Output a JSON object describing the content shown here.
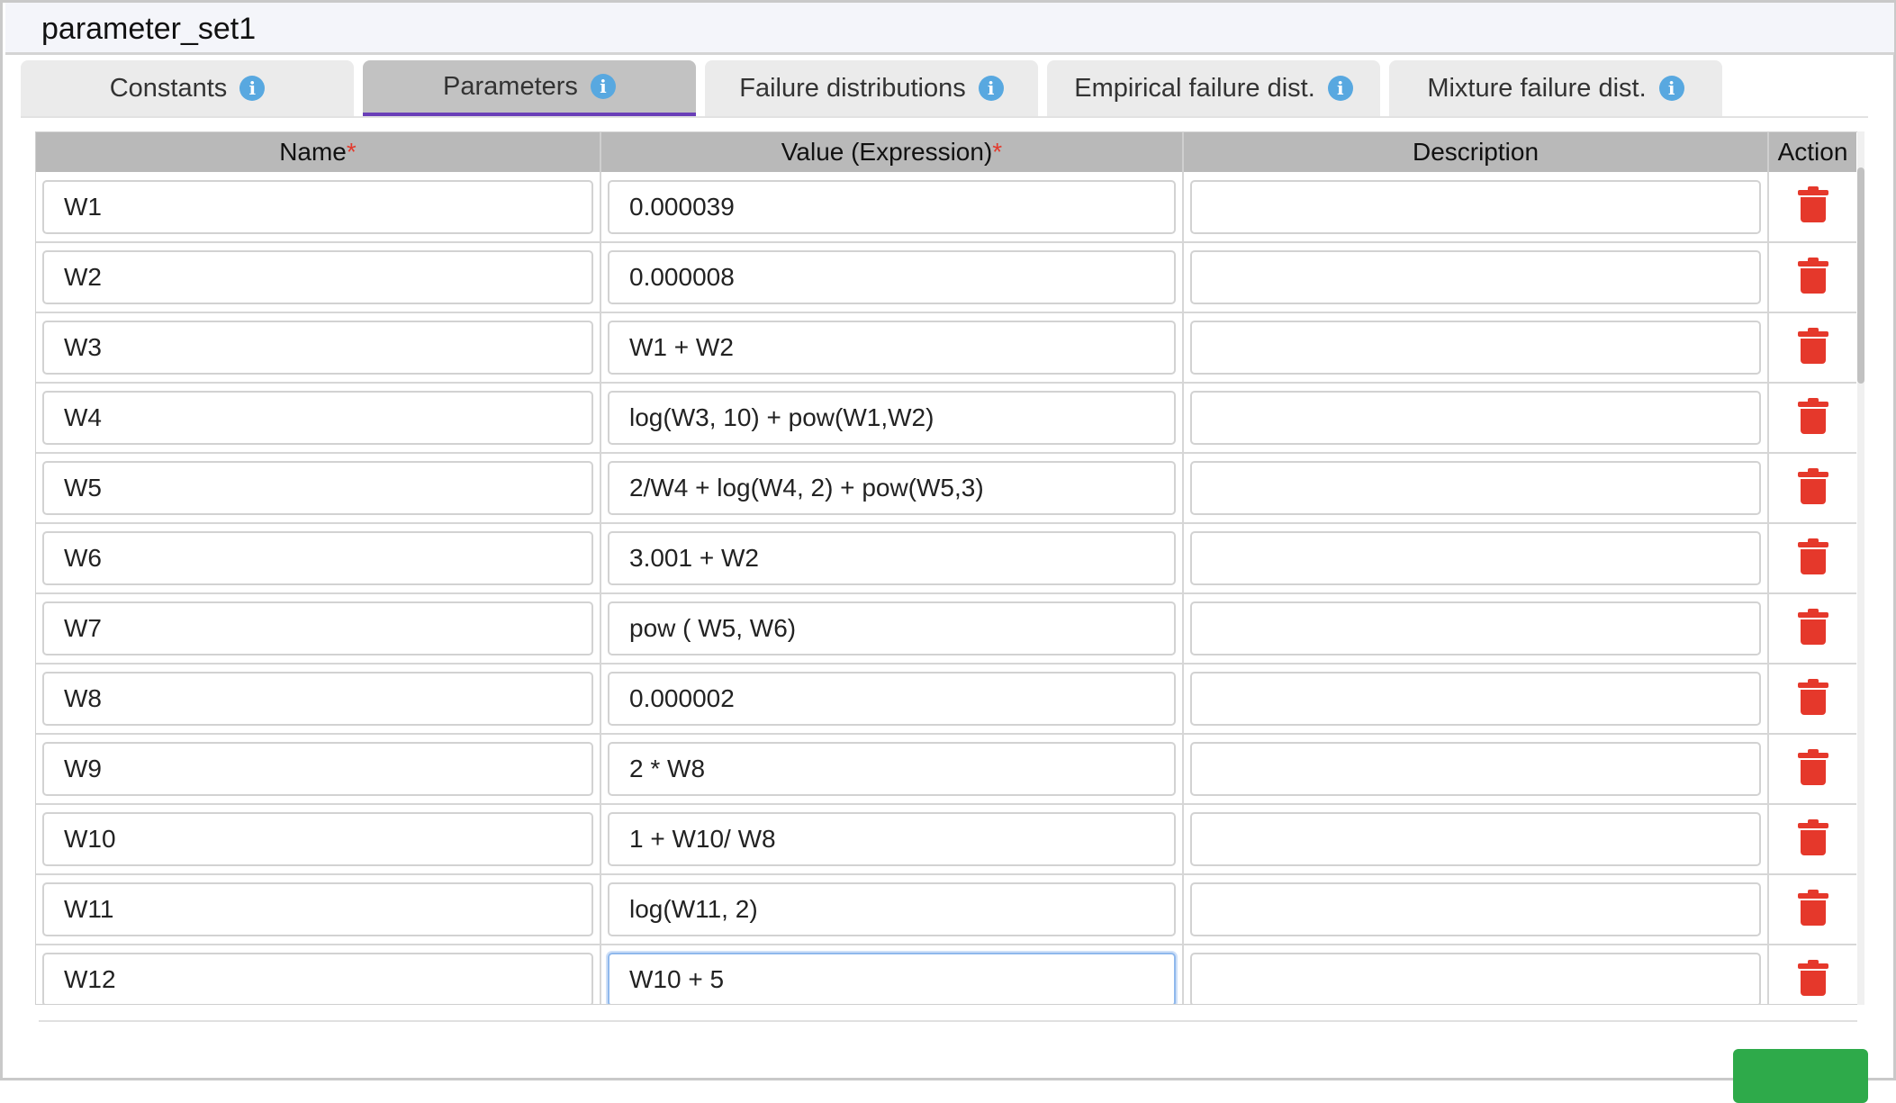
{
  "title": "parameter_set1",
  "tabs": [
    {
      "label": "Constants",
      "active": false
    },
    {
      "label": "Parameters",
      "active": true
    },
    {
      "label": "Failure distributions",
      "active": false
    },
    {
      "label": "Empirical failure dist.",
      "active": false
    },
    {
      "label": "Mixture failure dist.",
      "active": false
    }
  ],
  "table": {
    "headers": {
      "name": "Name",
      "value": "Value (Expression)",
      "description": "Description",
      "action": "Action",
      "required_mark": "*"
    },
    "rows": [
      {
        "name": "W1",
        "value": "0.000039",
        "description": ""
      },
      {
        "name": "W2",
        "value": "0.000008",
        "description": ""
      },
      {
        "name": "W3",
        "value": "W1 + W2",
        "description": ""
      },
      {
        "name": "W4",
        "value": "log(W3, 10) + pow(W1,W2)",
        "description": ""
      },
      {
        "name": "W5",
        "value": "2/W4 + log(W4, 2) + pow(W5,3)",
        "description": ""
      },
      {
        "name": "W6",
        "value": "3.001 + W2",
        "description": ""
      },
      {
        "name": "W7",
        "value": "pow ( W5, W6)",
        "description": ""
      },
      {
        "name": "W8",
        "value": "0.000002",
        "description": ""
      },
      {
        "name": "W9",
        "value": "2 * W8",
        "description": ""
      },
      {
        "name": "W10",
        "value": "1 + W10/ W8",
        "description": ""
      },
      {
        "name": "W11",
        "value": "log(W11, 2)",
        "description": ""
      },
      {
        "name": "W12",
        "value": "W10 + 5",
        "description": ""
      }
    ]
  },
  "colors": {
    "accent": "#6a3fb8",
    "delete": "#e5382b",
    "info": "#58a8e0",
    "save": "#2eaa4a"
  }
}
